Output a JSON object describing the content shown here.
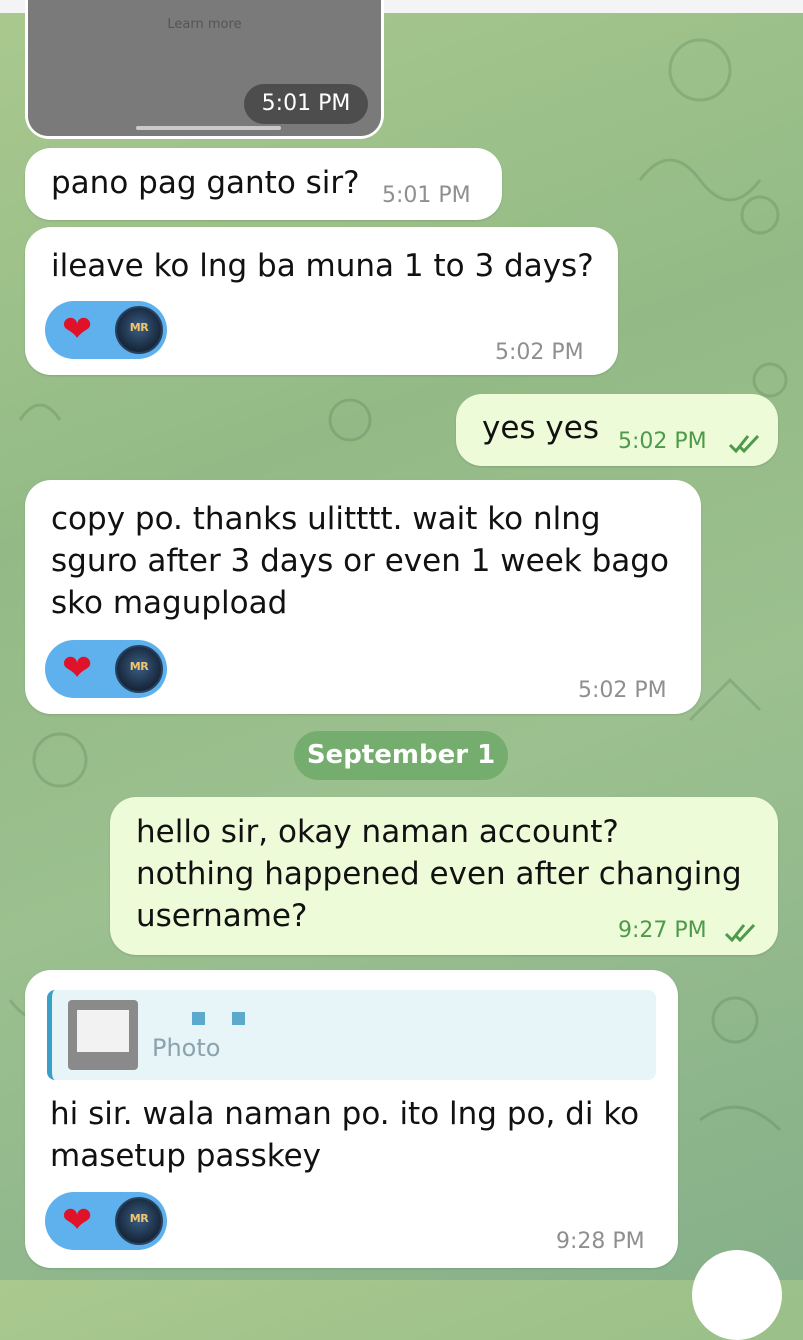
{
  "top_media": {
    "learn_more": "Learn more",
    "time": "5:01 PM"
  },
  "messages": [
    {
      "text": "pano pag ganto sir?",
      "time": "5:01 PM"
    },
    {
      "text": "ileave ko lng ba muna 1 to 3 days?",
      "time": "5:02 PM",
      "reaction": {
        "emoji": "❤",
        "avatar_label": "MR"
      }
    },
    {
      "text": "yes yes",
      "time": "5:02 PM"
    },
    {
      "text": "copy po. thanks ulitttt. wait ko  nlng\nsguro after 3 days or even 1 week bago\nsko magupload",
      "time": "5:02 PM",
      "reaction": {
        "emoji": "❤",
        "avatar_label": "MR"
      }
    },
    {
      "text": "hello sir, okay naman account?\nnothing happened even after changing\nusername?",
      "time": "9:27 PM"
    },
    {
      "text": "hi sir. wala naman po. ito lng po, di ko\nmasetup passkey",
      "time": "9:28 PM",
      "reply_label": "Photo",
      "reaction": {
        "emoji": "❤",
        "avatar_label": "MR"
      }
    }
  ],
  "date_separator": "September 1",
  "colors": {
    "incoming": "#ffffff",
    "outgoing": "#eefbd8",
    "reaction": "#5eb1ec",
    "date_pill": "#74ad6d",
    "ticks": "#4c9a4a"
  },
  "icons": [
    "double-check-icon",
    "heart-icon",
    "avatar"
  ]
}
